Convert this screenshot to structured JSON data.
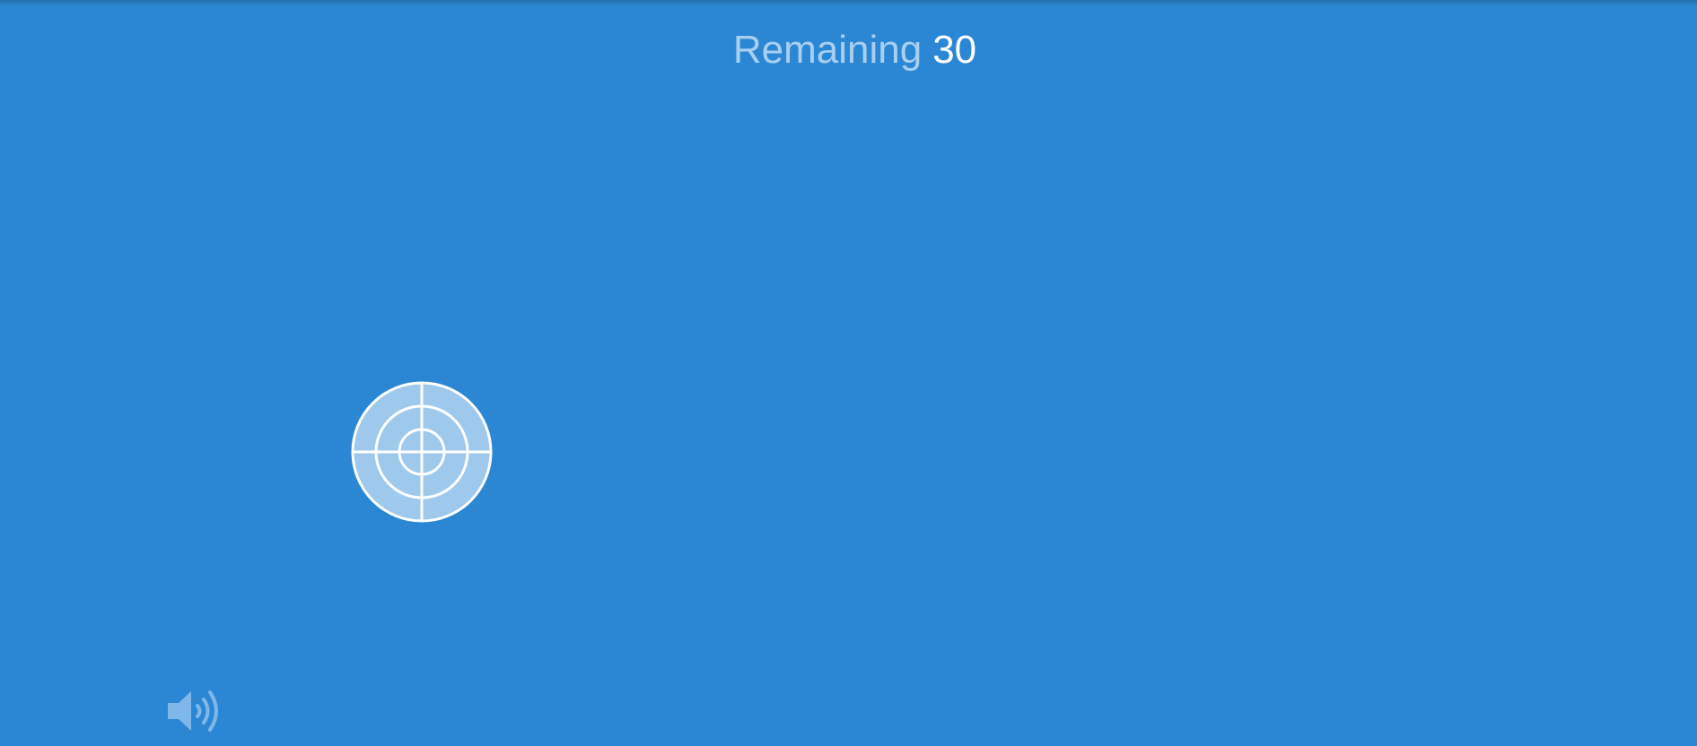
{
  "game": {
    "counter_label": "Remaining",
    "counter_value": "30"
  },
  "icons": {
    "target": "crosshair-target-icon",
    "sound": "speaker-volume-icon"
  },
  "colors": {
    "background": "#2b87d3",
    "counter_label": "#a7cff0",
    "counter_value": "#ffffff",
    "target_fill": "#9fc9ec",
    "target_stroke": "#ffffff",
    "sound_icon": "#7fb8e8"
  }
}
